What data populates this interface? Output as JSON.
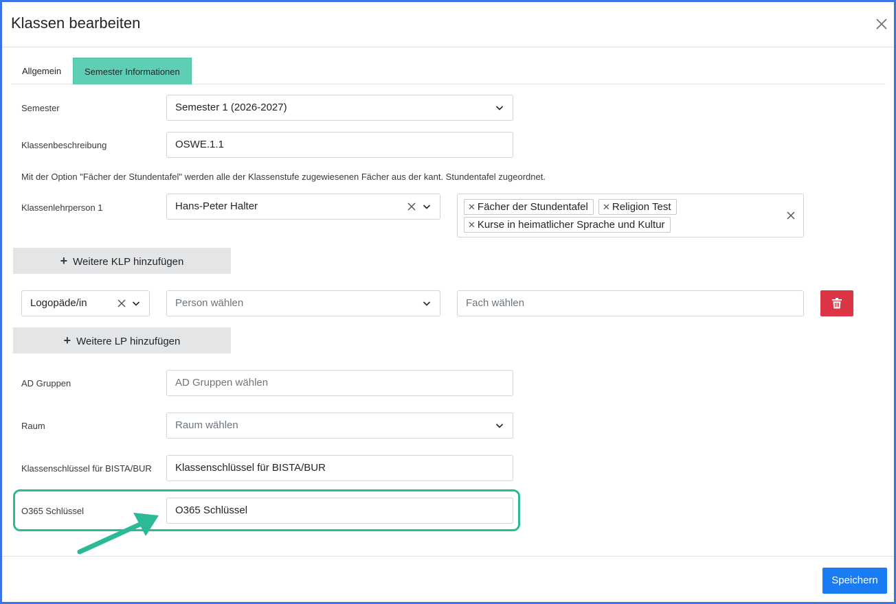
{
  "modal": {
    "title": "Klassen bearbeiten"
  },
  "tabs": [
    {
      "label": "Allgemein",
      "active": false
    },
    {
      "label": "Semester Informationen",
      "active": true
    }
  ],
  "semester": {
    "label": "Semester",
    "value": "Semester 1 (2026-2027)"
  },
  "class_description": {
    "label": "Klassenbeschreibung",
    "value": "OSWE.1.1"
  },
  "help_text": "Mit der Option \"Fächer der Stundentafel\" werden alle der Klassenstufe zugewiesenen Fächer aus der kant. Stundentafel zugeordnet.",
  "class_teacher": {
    "label": "Klassenlehrperson 1",
    "value": "Hans-Peter Halter",
    "tags": [
      "Fächer der Stundentafel",
      "Religion Test",
      "Kurse in heimatlicher Sprache und Kultur"
    ]
  },
  "add_klp_button": "Weitere KLP hinzufügen",
  "role_row": {
    "role_value": "Logopäde/in",
    "person_placeholder": "Person wählen",
    "subject_placeholder": "Fach wählen"
  },
  "add_lp_button": "Weitere LP hinzufügen",
  "ad_groups": {
    "label": "AD Gruppen",
    "placeholder": "AD Gruppen wählen"
  },
  "room": {
    "label": "Raum",
    "placeholder": "Raum wählen"
  },
  "bista_key": {
    "label": "Klassenschlüssel für BISTA/BUR",
    "placeholder": "Klassenschlüssel für BISTA/BUR"
  },
  "o365_key": {
    "label": "O365 Schlüssel",
    "placeholder": "O365 Schlüssel"
  },
  "save_button": "Speichern",
  "colors": {
    "frame_border": "#3b73e6",
    "active_tab": "#5ecfb5",
    "highlight": "#2bb997",
    "delete": "#dc3545",
    "primary": "#1a7cf2"
  }
}
